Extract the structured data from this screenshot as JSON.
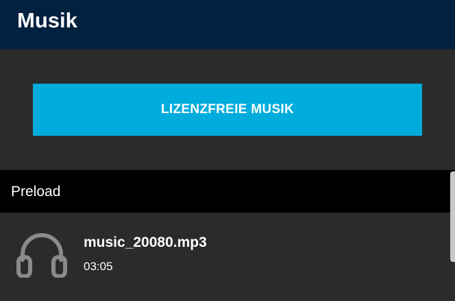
{
  "header": {
    "title": "Musik"
  },
  "license_button": {
    "label": "LIZENZFREIE MUSIK"
  },
  "section": {
    "title": "Preload"
  },
  "tracks": [
    {
      "name": "music_20080.mp3",
      "duration": "03:05",
      "icon": "headphones-icon"
    }
  ],
  "colors": {
    "header_bg": "#02213f",
    "accent": "#00acdc",
    "background": "#2b2b2b",
    "section_bg": "#000000",
    "icon": "#8a8a8a"
  }
}
